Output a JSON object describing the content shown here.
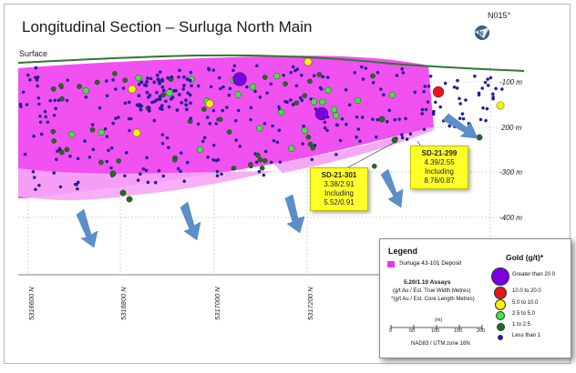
{
  "title": "Longitudinal Section – Surluga North Main",
  "surface_label": "Surface",
  "north_label": "N015°",
  "depth_labels": [
    "-100 m",
    "200 m",
    "-300 m",
    "-400 m"
  ],
  "easting_labels": [
    "5316600 N",
    "5316800 N",
    "5317000 N",
    "5317200 N"
  ],
  "callouts": [
    {
      "hole": "SD-21-301",
      "line1": "3.38/2.91",
      "line2": "Including",
      "line3": "5.52/0.91"
    },
    {
      "hole": "SD-21-299",
      "line1": "4.39/2.55",
      "line2": "Including",
      "line3": "8.76/0.87"
    }
  ],
  "legend": {
    "title": "Legend",
    "deposit_label": "Surluga 43-101 Deposit",
    "assay_title": "5.20/1.10 Assays",
    "assay_line1": "(g/t Au / Est. True Width Metres)",
    "assay_line2": "*(g/t Au / Est. Core Length Metres)",
    "scale_unit": "(m)",
    "scale_ticks": [
      "0",
      "50",
      "100",
      "150",
      "200"
    ],
    "datum": "NAD83 / UTM zone 16N",
    "gold_title": "Gold (g/t)*",
    "gold_classes": [
      {
        "label": "Greater than 20.0",
        "color": "#7a00e0"
      },
      {
        "label": "10.0 to 20.0",
        "color": "#e8141c"
      },
      {
        "label": "5.0 to 10.0",
        "color": "#f5f500"
      },
      {
        "label": "2.5 to 5.0",
        "color": "#3ee83e"
      },
      {
        "label": "1 to 2.5",
        "color": "#1b6e1b"
      },
      {
        "label": "Less than 1",
        "color": "#1a1ad0"
      }
    ]
  },
  "colors": {
    "deposit": "#ee33ee",
    "surface_line": "#2d7a2d",
    "arrow": "#5b8fc9"
  }
}
